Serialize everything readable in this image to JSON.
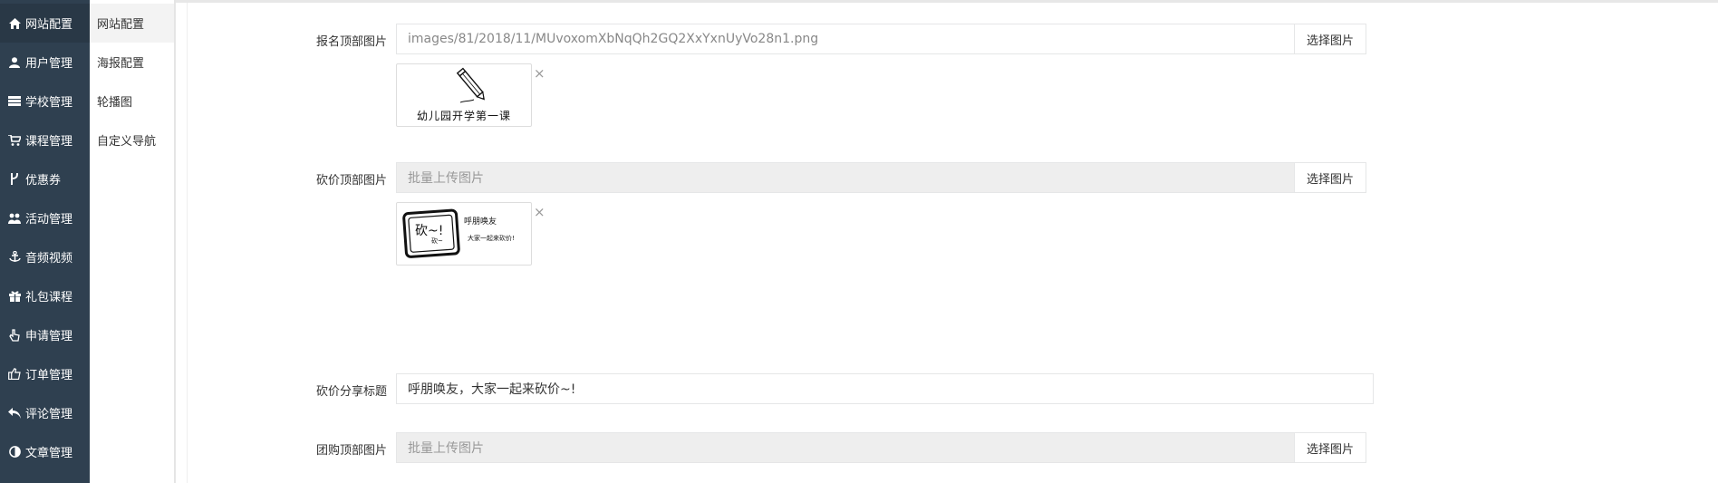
{
  "sidebar": {
    "items": [
      {
        "icon": "home-icon",
        "label": "网站配置"
      },
      {
        "icon": "user-icon",
        "label": "用户管理"
      },
      {
        "icon": "server-icon",
        "label": "学校管理"
      },
      {
        "icon": "cart-icon",
        "label": "课程管理"
      },
      {
        "icon": "fork-icon",
        "label": "优惠券"
      },
      {
        "icon": "group-icon",
        "label": "活动管理"
      },
      {
        "icon": "anchor-icon",
        "label": "音频视频"
      },
      {
        "icon": "gift-icon",
        "label": "礼包课程"
      },
      {
        "icon": "hand-pointer-icon",
        "label": "申请管理"
      },
      {
        "icon": "thumbs-up-icon",
        "label": "订单管理"
      },
      {
        "icon": "reply-icon",
        "label": "评论管理"
      },
      {
        "icon": "adjust-icon",
        "label": "文章管理"
      }
    ]
  },
  "subnav": {
    "items": [
      {
        "label": "网站配置"
      },
      {
        "label": "海报配置"
      },
      {
        "label": "轮播图"
      },
      {
        "label": "自定义导航"
      }
    ]
  },
  "form": {
    "signup_top_image": {
      "label": "报名顶部图片",
      "value": "images/81/2018/11/MUvoxomXbNqQh2GQ2XxYxnUyVo28n1.png",
      "button": "选择图片",
      "thumb_caption": "幼儿园开学第一课",
      "remove": "×"
    },
    "bargain_top_image": {
      "label": "砍价顶部图片",
      "placeholder": "批量上传图片",
      "button": "选择图片",
      "thumb_text_main": "砍~!",
      "thumb_text_sub": "砍~",
      "thumb_text_right1": "呼朋唤友",
      "thumb_text_right2": "大家一起来砍价!",
      "remove": "×"
    },
    "bargain_share_title": {
      "label": "砍价分享标题",
      "value": "呼朋唤友，大家一起来砍价~!"
    },
    "group_top_image": {
      "label": "团购顶部图片",
      "placeholder": "批量上传图片",
      "button": "选择图片"
    }
  }
}
